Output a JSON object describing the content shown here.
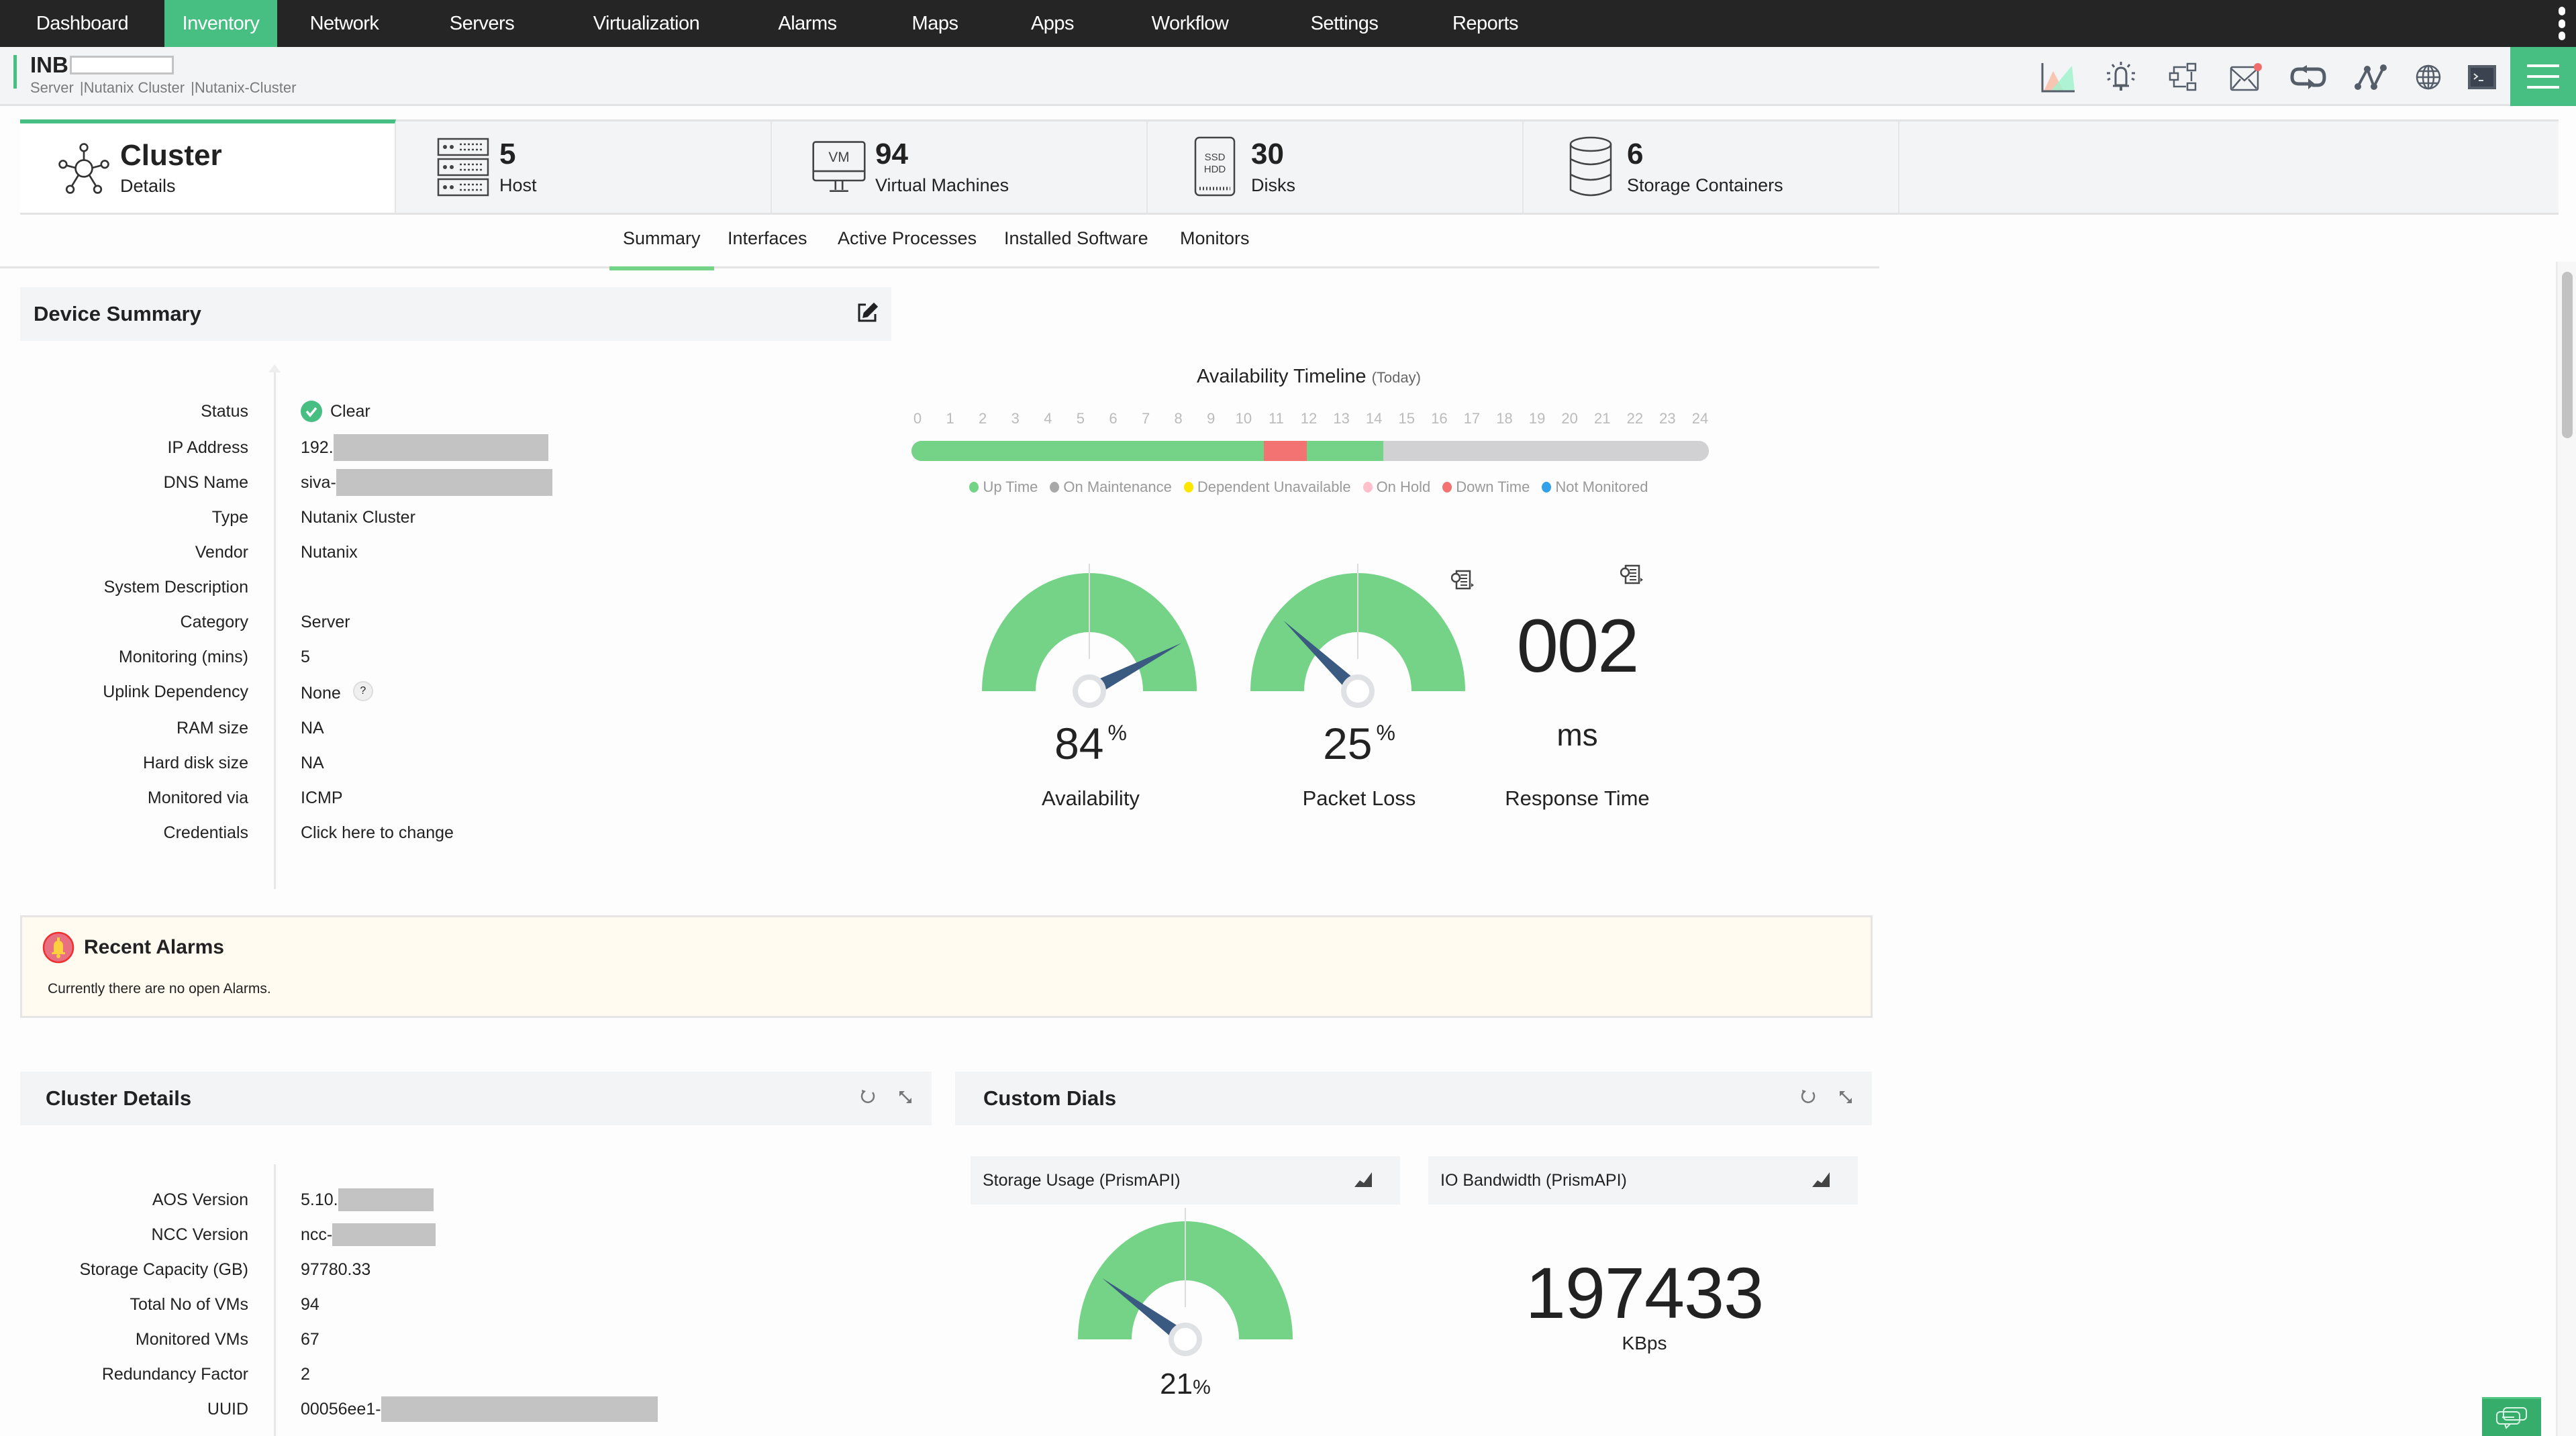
{
  "nav": {
    "items": [
      {
        "label": "Dashboard",
        "active": false
      },
      {
        "label": "Inventory",
        "active": true
      },
      {
        "label": "Network",
        "active": false
      },
      {
        "label": "Servers",
        "active": false
      },
      {
        "label": "Virtualization",
        "active": false
      },
      {
        "label": "Alarms",
        "active": false
      },
      {
        "label": "Maps",
        "active": false
      },
      {
        "label": "Apps",
        "active": false
      },
      {
        "label": "Workflow",
        "active": false
      },
      {
        "label": "Settings",
        "active": false
      },
      {
        "label": "Reports",
        "active": false
      }
    ]
  },
  "device": {
    "name_prefix": "INB",
    "breadcrumb": [
      "Server",
      "|Nutanix Cluster",
      "|Nutanix-Cluster"
    ]
  },
  "toolbar": {
    "icons": [
      "area-chart-icon",
      "alarm-bell-icon",
      "workflow-icon",
      "mail-icon",
      "sync-icon",
      "topology-icon",
      "globe-icon",
      "terminal-icon"
    ],
    "mail_badge_color": "#f26b6b"
  },
  "cards": [
    {
      "value": "Cluster",
      "label": "Details",
      "icon": "cluster-icon",
      "active": true
    },
    {
      "value": "5",
      "label": "Host",
      "icon": "server-rack-icon",
      "active": false
    },
    {
      "value": "94",
      "label": "Virtual Machines",
      "icon": "vm-monitor-icon",
      "active": false
    },
    {
      "value": "30",
      "label": "Disks",
      "icon": "disk-icon",
      "active": false
    },
    {
      "value": "6",
      "label": "Storage Containers",
      "icon": "database-icon",
      "active": false
    }
  ],
  "tabs": [
    {
      "label": "Summary",
      "active": true
    },
    {
      "label": "Interfaces",
      "active": false
    },
    {
      "label": "Active Processes",
      "active": false
    },
    {
      "label": "Installed Software",
      "active": false
    },
    {
      "label": "Monitors",
      "active": false
    }
  ],
  "device_summary": {
    "title": "Device Summary",
    "rows": [
      {
        "key": "Status",
        "value": "Clear"
      },
      {
        "key": "IP Address",
        "value": "192."
      },
      {
        "key": "DNS Name",
        "value": "siva-"
      },
      {
        "key": "Type",
        "value": "Nutanix Cluster"
      },
      {
        "key": "Vendor",
        "value": "Nutanix"
      },
      {
        "key": "System Description",
        "value": ""
      },
      {
        "key": "Category",
        "value": "Server"
      },
      {
        "key": "Monitoring (mins)",
        "value": "5"
      },
      {
        "key": "Uplink Dependency",
        "value": "None"
      },
      {
        "key": "RAM size",
        "value": "NA"
      },
      {
        "key": "Hard disk size",
        "value": "NA"
      },
      {
        "key": "Monitored via",
        "value": "ICMP"
      },
      {
        "key": "Credentials",
        "value": "Click here to change"
      }
    ],
    "help_glyph": "?"
  },
  "availability": {
    "title": "Availability Timeline",
    "subtitle": "(Today)",
    "hours": [
      "0",
      "1",
      "2",
      "3",
      "4",
      "5",
      "6",
      "7",
      "8",
      "9",
      "10",
      "11",
      "12",
      "13",
      "14",
      "15",
      "16",
      "17",
      "18",
      "19",
      "20",
      "21",
      "22",
      "23",
      "24"
    ],
    "segments": [
      {
        "from": 0,
        "to": 10.6,
        "state": "up"
      },
      {
        "from": 10.6,
        "to": 11.9,
        "state": "down"
      },
      {
        "from": 11.9,
        "to": 14.2,
        "state": "up"
      },
      {
        "from": 14.2,
        "to": 24,
        "state": "none"
      }
    ],
    "legend": [
      {
        "label": "Up Time",
        "color": "#75d387"
      },
      {
        "label": "On Maintenance",
        "color": "#a8a8a8"
      },
      {
        "label": "Dependent Unavailable",
        "color": "#ffe600"
      },
      {
        "label": "On Hold",
        "color": "#ffc0cb"
      },
      {
        "label": "Down Time",
        "color": "#f37272"
      },
      {
        "label": "Not Monitored",
        "color": "#33a1e8"
      }
    ],
    "colors": {
      "up": "#75d387",
      "down": "#f37272",
      "none": "#d1d1d3"
    }
  },
  "gauges": [
    {
      "name": "Availability",
      "value": 84,
      "unit": "%"
    },
    {
      "name": "Packet Loss",
      "value": 25,
      "unit": "%"
    }
  ],
  "response_time": {
    "value": "002",
    "unit": "ms",
    "label": "Response Time"
  },
  "alarms": {
    "title": "Recent Alarms",
    "message": "Currently there are no open Alarms."
  },
  "cluster_details": {
    "title": "Cluster Details",
    "rows": [
      {
        "key": "AOS Version",
        "value": "5.10."
      },
      {
        "key": "NCC Version",
        "value": "ncc-"
      },
      {
        "key": "Storage Capacity (GB)",
        "value": "97780.33"
      },
      {
        "key": "Total No of VMs",
        "value": "94"
      },
      {
        "key": "Monitored VMs",
        "value": "67"
      },
      {
        "key": "Redundancy Factor",
        "value": "2"
      },
      {
        "key": "UUID",
        "value": "00056ee1-"
      }
    ]
  },
  "custom_dials": {
    "title": "Custom Dials",
    "storage": {
      "title": "Storage Usage (PrismAPI)",
      "value": 21,
      "unit": "%"
    },
    "io": {
      "title": "IO Bandwidth (PrismAPI)",
      "value": "197433",
      "unit": "KBps"
    }
  },
  "colors": {
    "accent": "#47be82",
    "gauge_fill": "#75d387",
    "needle": "#3b5a82",
    "topnav": "#252525"
  }
}
